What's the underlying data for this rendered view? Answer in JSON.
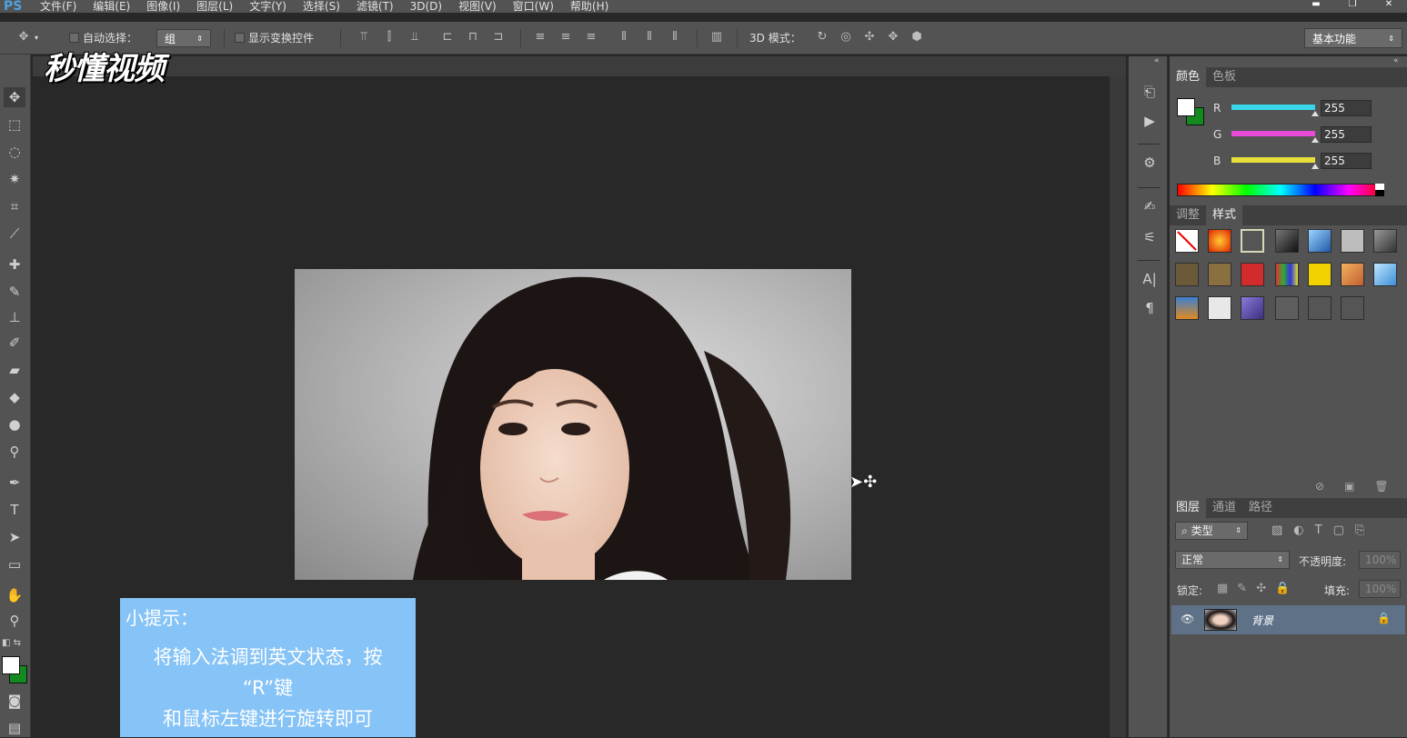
{
  "app": {
    "logo": "PS",
    "menus": [
      "文件(F)",
      "编辑(E)",
      "图像(I)",
      "图层(L)",
      "文字(Y)",
      "选择(S)",
      "滤镜(T)",
      "3D(D)",
      "视图(V)",
      "窗口(W)",
      "帮助(H)"
    ],
    "window_controls": [
      "▬",
      "❐",
      "✕"
    ]
  },
  "options_bar": {
    "auto_select_label": "自动选择：",
    "auto_select_value": "组",
    "show_transform_label": "显示变换控件",
    "mode_3d_label": "3D 模式：",
    "workspace_value": "基本功能"
  },
  "watermark": "秒懂视频",
  "tip": {
    "title": "小提示：",
    "lines": [
      "将输入法调到英文状态，按",
      "“R”键",
      "和鼠标左键进行旋转即可"
    ]
  },
  "panels": {
    "color": {
      "tabs": [
        "颜色",
        "色板"
      ],
      "channels": [
        {
          "label": "R",
          "value": "255",
          "color": "#37d6e8"
        },
        {
          "label": "G",
          "value": "255",
          "color": "#e84ad8"
        },
        {
          "label": "B",
          "value": "255",
          "color": "#e8e03a"
        }
      ]
    },
    "styles": {
      "tabs": [
        "调整",
        "样式"
      ]
    },
    "layers": {
      "tabs": [
        "图层",
        "通道",
        "路径"
      ],
      "filter_label": "类型",
      "blend_mode": "正常",
      "opacity_label": "不透明度:",
      "opacity_value": "100%",
      "lock_label": "锁定:",
      "fill_label": "填充:",
      "fill_value": "100%",
      "layer_name": "背景"
    }
  },
  "colors": {
    "foreground": "#ffffff",
    "background": "#138a1e",
    "tip_bg": "#86c3f6"
  }
}
